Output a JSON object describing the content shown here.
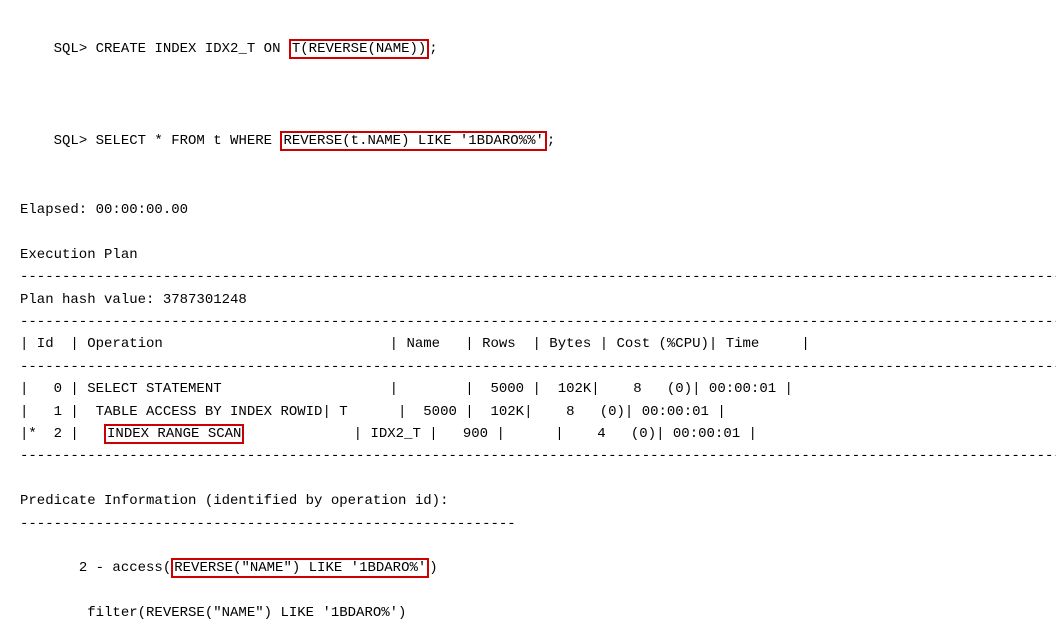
{
  "sql": {
    "line1_prefix": "SQL> ",
    "line1_keyword": "CREATE",
    "line1_mid": " INDEX IDX2_T ON ",
    "line1_highlighted": "T(REVERSE(NAME))",
    "line1_suffix": ";",
    "line2_prefix": "SQL> SELECT * FROM t WHERE ",
    "line2_highlighted": "REVERSE(t.NAME) LIKE '1BDARO%%'",
    "line2_suffix": ";"
  },
  "elapsed": {
    "label": "Elapsed: 00:00:00.00"
  },
  "execution_plan": {
    "title": "Execution Plan",
    "separator": "--------------------------------------------------------------------",
    "hash_label": "Plan hash value: 3787301248",
    "separator2": "--------------------------------------------------------------------",
    "header": {
      "id": "Id",
      "operation": "Operation",
      "name": "Name",
      "rows": "Rows",
      "bytes": "Bytes",
      "cost_cpu": "Cost (%CPU)",
      "time": "Time"
    },
    "rows": [
      {
        "prefix": "  ",
        "id": "0",
        "operation": "SELECT STATEMENT      ",
        "name": "       ",
        "rows": "5000",
        "bytes": "102K",
        "cost": "8",
        "cpu": "(0)",
        "time": "00:00:01",
        "marker": " "
      },
      {
        "prefix": "  ",
        "id": "1",
        "operation": "TABLE ACCESS BY INDEX ROWID",
        "name": "T      ",
        "rows": "5000",
        "bytes": "102K",
        "cost": "8",
        "cpu": "(0)",
        "time": "00:00:01",
        "marker": " "
      },
      {
        "prefix": "* ",
        "id": "2",
        "operation_highlighted": "INDEX RANGE SCAN",
        "name": "IDX2_T ",
        "rows": "900",
        "bytes": "",
        "cost": "4",
        "cpu": "(0)",
        "time": "00:00:01",
        "marker": "*"
      }
    ],
    "separator3": "--------------------------------------------------------------------"
  },
  "predicate": {
    "title": "Predicate Information (identified by operation id):",
    "separator": "-----------------------------------------------------------",
    "line1_prefix": "   2 - access(",
    "line1_highlighted": "REVERSE(\"NAME\") LIKE '1BDARO%'",
    "line1_suffix": ")",
    "line2": "        filter(REVERSE(\"NAME\") LIKE '1BDARO%')"
  }
}
